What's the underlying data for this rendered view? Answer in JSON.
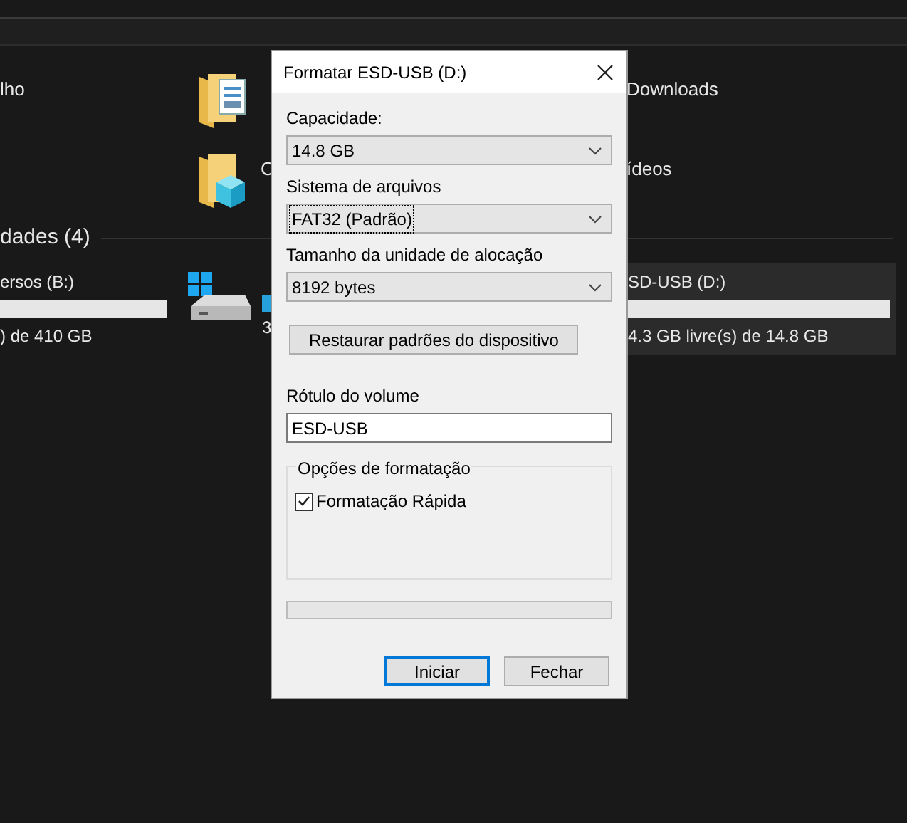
{
  "explorer": {
    "folders": [
      {
        "label_left": "lho",
        "label_right": "Downloads",
        "kind": "document"
      },
      {
        "label_mid": "C",
        "label_right": "ídeos",
        "kind": "cube"
      }
    ],
    "section": {
      "title": "dades (4)"
    },
    "drives": [
      {
        "name": "ersos (B:)",
        "info": ") de 410 GB"
      },
      {
        "info": "3"
      },
      {
        "name": "SD-USB (D:)",
        "info": "4.3 GB livre(s) de 14.8 GB",
        "selected": true
      }
    ]
  },
  "dialog": {
    "title": "Formatar ESD-USB (D:)",
    "fields": [
      {
        "kind": "combo",
        "label": "Capacidade:",
        "value": "14.8 GB",
        "focused": false
      },
      {
        "kind": "combo",
        "label": "Sistema de arquivos",
        "value": "FAT32 (Padrão)",
        "focused": true
      },
      {
        "kind": "combo",
        "label": "Tamanho da unidade de alocação",
        "value": "8192 bytes",
        "focused": false
      },
      {
        "kind": "button",
        "value": "Restaurar padrões do dispositivo"
      },
      {
        "kind": "text",
        "label": "Rótulo do volume",
        "value": "ESD-USB"
      }
    ],
    "options": {
      "title": "Opções de formatação",
      "checkboxes": [
        {
          "label": "Formatação Rápida",
          "checked": true
        }
      ]
    },
    "buttons": [
      {
        "label": "Iniciar",
        "default": true
      },
      {
        "label": "Fechar",
        "default": false
      }
    ]
  }
}
